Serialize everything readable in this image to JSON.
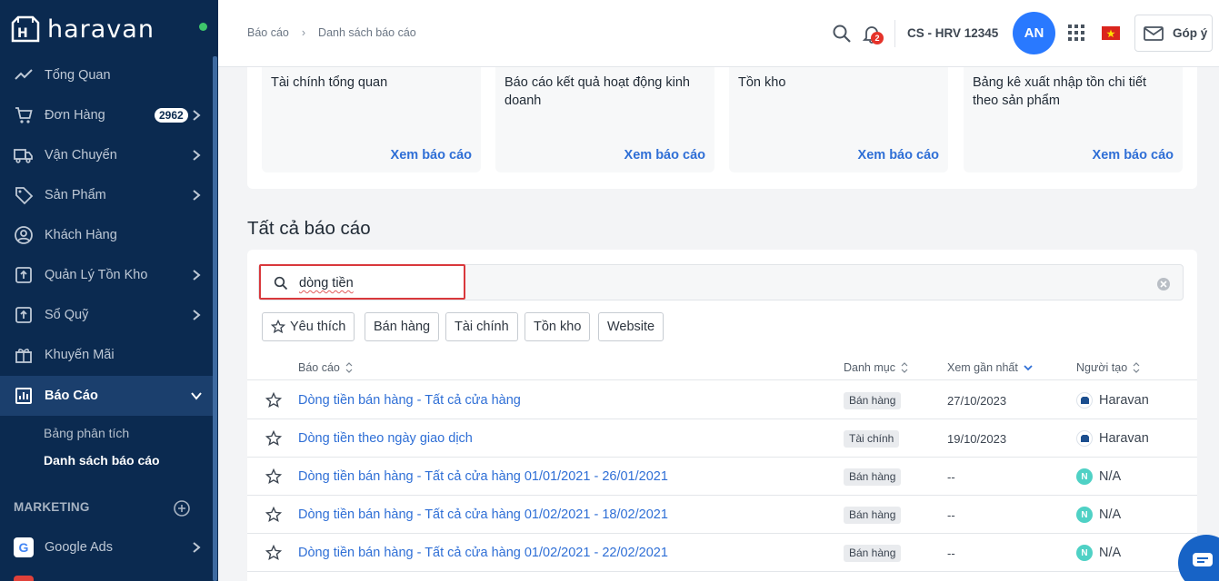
{
  "brand": {
    "name": "haravan",
    "status_color": "#3ec66b"
  },
  "sidebar": {
    "items": [
      {
        "label": "Tổng Quan",
        "icon": "trend-line-icon"
      },
      {
        "label": "Đơn Hàng",
        "icon": "cart-icon",
        "badge": "2962"
      },
      {
        "label": "Vận Chuyển",
        "icon": "truck-icon"
      },
      {
        "label": "Sản Phẩm",
        "icon": "tag-icon"
      },
      {
        "label": "Khách Hàng",
        "icon": "user-circle-icon"
      },
      {
        "label": "Quản Lý Tồn Kho",
        "icon": "inventory-icon"
      },
      {
        "label": "Sổ Quỹ",
        "icon": "cashbook-icon"
      },
      {
        "label": "Khuyến Mãi",
        "icon": "gift-icon"
      },
      {
        "label": "Báo Cáo",
        "icon": "report-chart-icon"
      }
    ],
    "sub_items": [
      {
        "label": "Bảng phân tích"
      },
      {
        "label": "Danh sách báo cáo"
      }
    ],
    "section_label": "MARKETING",
    "google_ads": {
      "label": "Google Ads",
      "icon_letter": "G"
    }
  },
  "topbar": {
    "breadcrumb": [
      "Báo cáo",
      "Danh sách báo cáo"
    ],
    "bell_count": "2",
    "store_name": "CS - HRV 12345",
    "avatar_initials": "AN",
    "feedback_label": "Góp ý"
  },
  "featured_reports": [
    {
      "title": "Tài chính tổng quan",
      "link": "Xem báo cáo"
    },
    {
      "title": "Báo cáo kết quả hoạt động kinh doanh",
      "link": "Xem báo cáo"
    },
    {
      "title": "Tồn kho",
      "link": "Xem báo cáo"
    },
    {
      "title": "Bảng kê xuất nhập tồn chi tiết theo sản phẩm",
      "link": "Xem báo cáo"
    }
  ],
  "all_reports": {
    "title": "Tất cả báo cáo",
    "search_value": "dòng tiền",
    "filters": [
      "Yêu thích",
      "Bán hàng",
      "Tài chính",
      "Tồn kho",
      "Website"
    ],
    "columns": [
      "Báo cáo",
      "Danh mục",
      "Xem gần nhất",
      "Người tạo"
    ],
    "rows": [
      {
        "name": "Dòng tiền bán hàng - Tất cả cửa hàng",
        "category": "Bán hàng",
        "last_viewed": "27/10/2023",
        "creator": "Haravan",
        "creator_type": "haravan"
      },
      {
        "name": "Dòng tiền theo ngày giao dịch",
        "category": "Tài chính",
        "last_viewed": "19/10/2023",
        "creator": "Haravan",
        "creator_type": "haravan"
      },
      {
        "name": "Dòng tiền bán hàng - Tất cả cửa hàng 01/01/2021 - 26/01/2021",
        "category": "Bán hàng",
        "last_viewed": "--",
        "creator": "N/A",
        "creator_type": "na"
      },
      {
        "name": "Dòng tiền bán hàng - Tất cả cửa hàng 01/02/2021 - 18/02/2021",
        "category": "Bán hàng",
        "last_viewed": "--",
        "creator": "N/A",
        "creator_type": "na"
      },
      {
        "name": "Dòng tiền bán hàng - Tất cả cửa hàng 01/02/2021 - 22/02/2021",
        "category": "Bán hàng",
        "last_viewed": "--",
        "creator": "N/A",
        "creator_type": "na"
      }
    ]
  },
  "colors": {
    "sidebar_bg": "#0b2a50",
    "link": "#2f6fd6",
    "avatar": "#2979ff",
    "highlight_border": "#d9383c",
    "chat_fab": "#1763c6"
  }
}
